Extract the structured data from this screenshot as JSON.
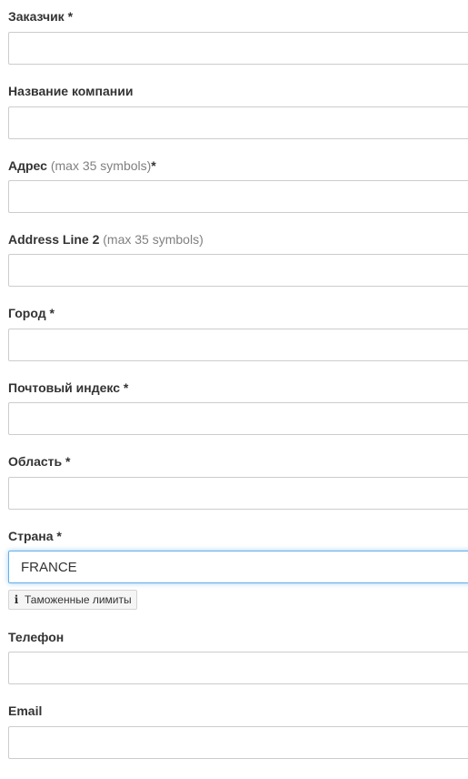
{
  "form": {
    "customer": {
      "label": "Заказчик",
      "required_mark": " *",
      "value": ""
    },
    "company": {
      "label": "Название компании",
      "value": ""
    },
    "address": {
      "label": "Адрес",
      "hint": " (max 35 symbols)",
      "required_mark": "*",
      "value": ""
    },
    "address2": {
      "label": "Address Line 2",
      "hint": " (max 35 symbols)",
      "value": ""
    },
    "city": {
      "label": "Город",
      "required_mark": " *",
      "value": ""
    },
    "postal_code": {
      "label": "Почтовый индекс",
      "required_mark": " *",
      "value": ""
    },
    "region": {
      "label": "Область",
      "required_mark": " *",
      "value": ""
    },
    "country": {
      "label": "Страна",
      "required_mark": " *",
      "value": "FRANCE"
    },
    "customs_limits": {
      "icon": "info-icon",
      "label": "Таможенные лимиты"
    },
    "phone": {
      "label": "Телефон",
      "value": ""
    },
    "email": {
      "label": "Email",
      "value": ""
    }
  },
  "colors": {
    "label": "#333333",
    "hint": "#808080",
    "input_border": "#cccccc",
    "focus_border": "#66afe9"
  }
}
